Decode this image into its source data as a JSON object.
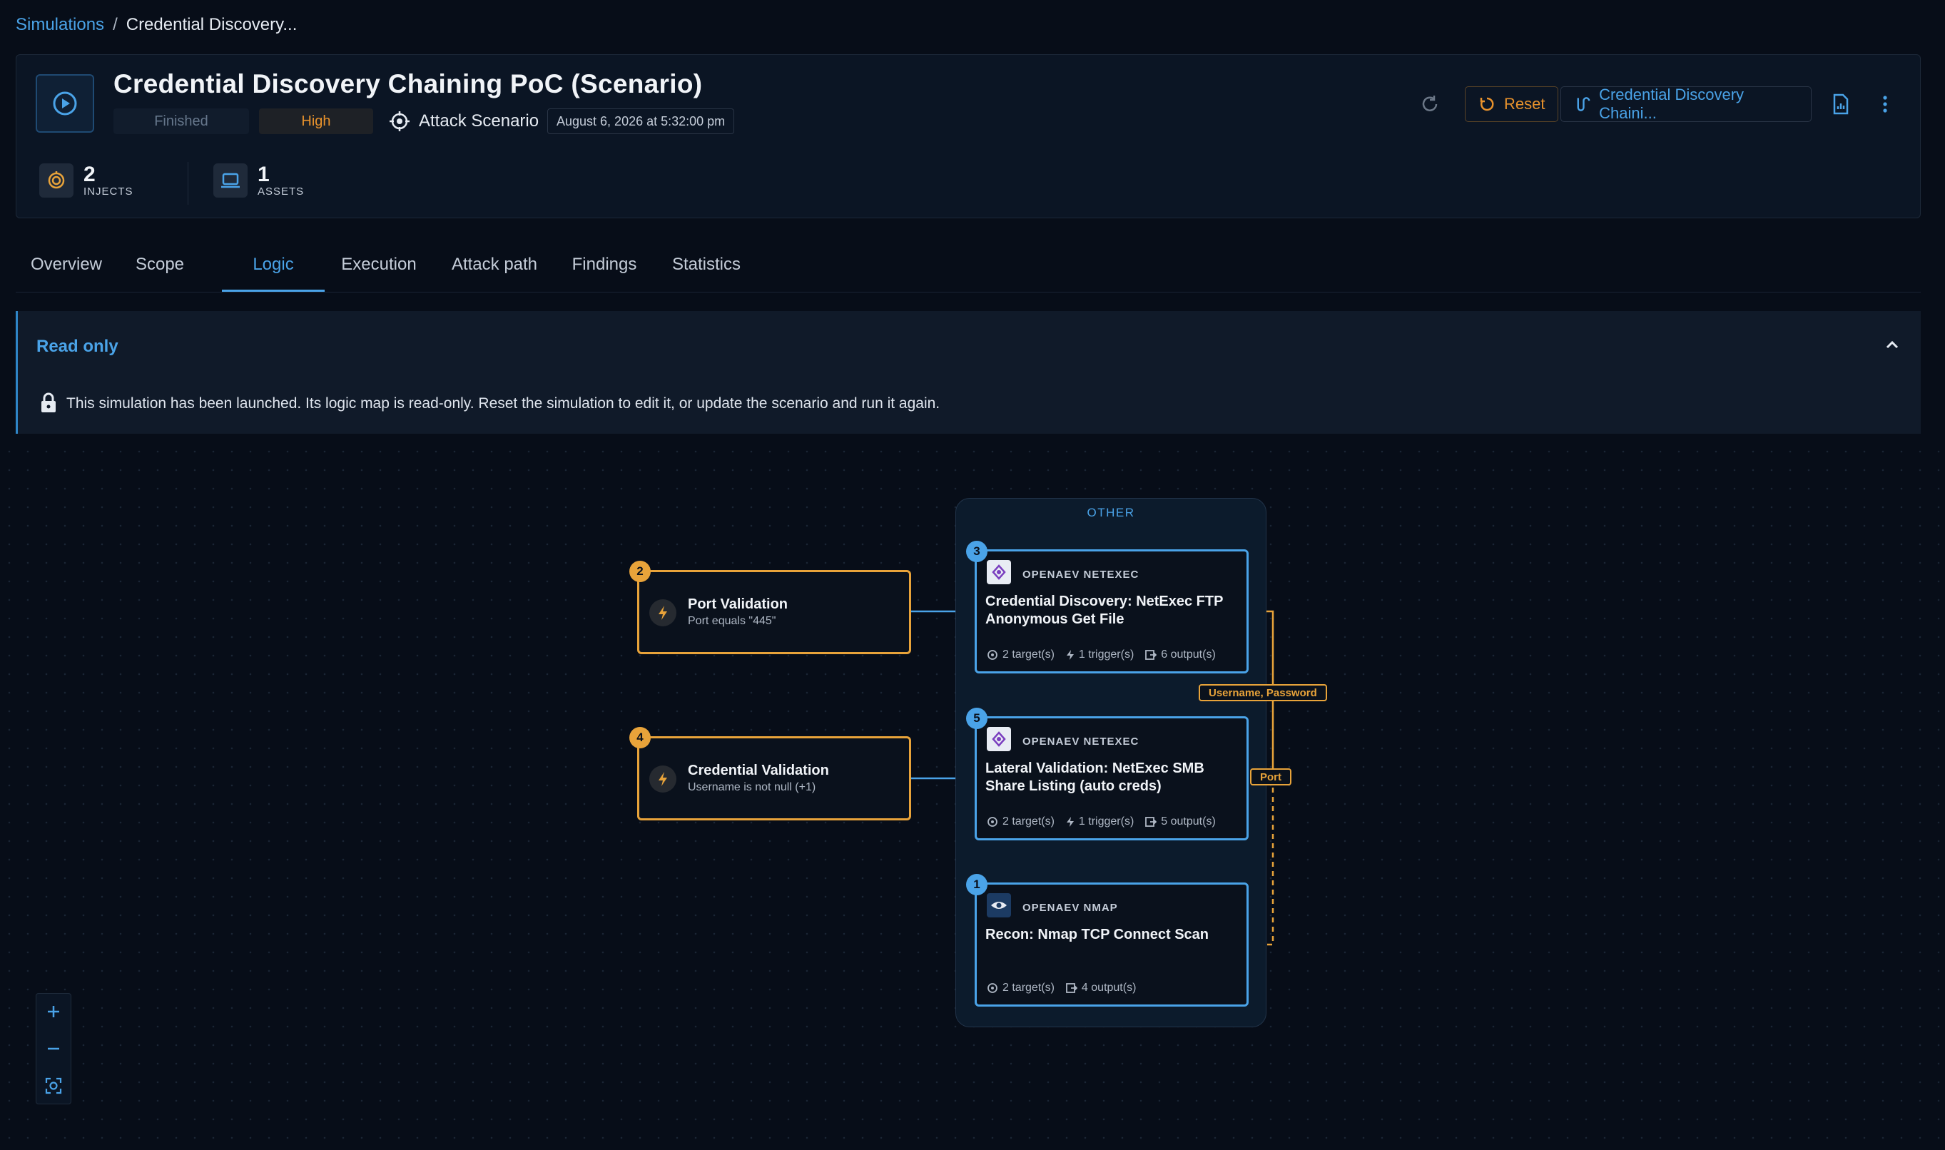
{
  "breadcrumb": {
    "parent": "Simulations",
    "separator": "/",
    "current": "Credential Discovery..."
  },
  "header": {
    "title": "Credential Discovery Chaining PoC (Scenario)",
    "status": "Finished",
    "severity": "High",
    "kind": "Attack Scenario",
    "date": "August 6, 2026 at 5:32:00 pm",
    "reset_label": "Reset",
    "scenario_link": "Credential Discovery Chaini...",
    "stats": [
      {
        "value": "2",
        "label": "INJECTS"
      },
      {
        "value": "1",
        "label": "ASSETS"
      }
    ]
  },
  "tabs": [
    "Overview",
    "Scope",
    "Logic",
    "Execution",
    "Attack path",
    "Findings",
    "Statistics"
  ],
  "active_tab": "Logic",
  "banner": {
    "title": "Read only",
    "message": "This simulation has been launched. Its logic map is read-only. Reset the simulation to edit it, or update the scenario and run it again."
  },
  "canvas": {
    "group_label": "OTHER",
    "conditions": [
      {
        "badge": "2",
        "title": "Port Validation",
        "subtitle": "Port equals \"445\""
      },
      {
        "badge": "4",
        "title": "Credential Validation",
        "subtitle": "Username is not null (+1)"
      }
    ],
    "injects": [
      {
        "badge": "3",
        "provider": "OPENAEV NETEXEC",
        "name": "Credential Discovery: NetExec FTP Anonymous Get File",
        "targets": "2 target(s)",
        "triggers": "1 trigger(s)",
        "outputs": "6 output(s)"
      },
      {
        "badge": "5",
        "provider": "OPENAEV NETEXEC",
        "name": "Lateral Validation: NetExec SMB Share Listing (auto creds)",
        "targets": "2 target(s)",
        "triggers": "1 trigger(s)",
        "outputs": "5 output(s)"
      },
      {
        "badge": "1",
        "provider": "OPENAEV NMAP",
        "name": "Recon: Nmap TCP Connect Scan",
        "targets": "2 target(s)",
        "outputs": "4 output(s)"
      }
    ],
    "edge_labels": {
      "credentials": "Username, Password",
      "port": "Port"
    }
  },
  "colors": {
    "accent": "#4aa3e8",
    "warning": "#e8a33a",
    "background": "#070d18"
  }
}
